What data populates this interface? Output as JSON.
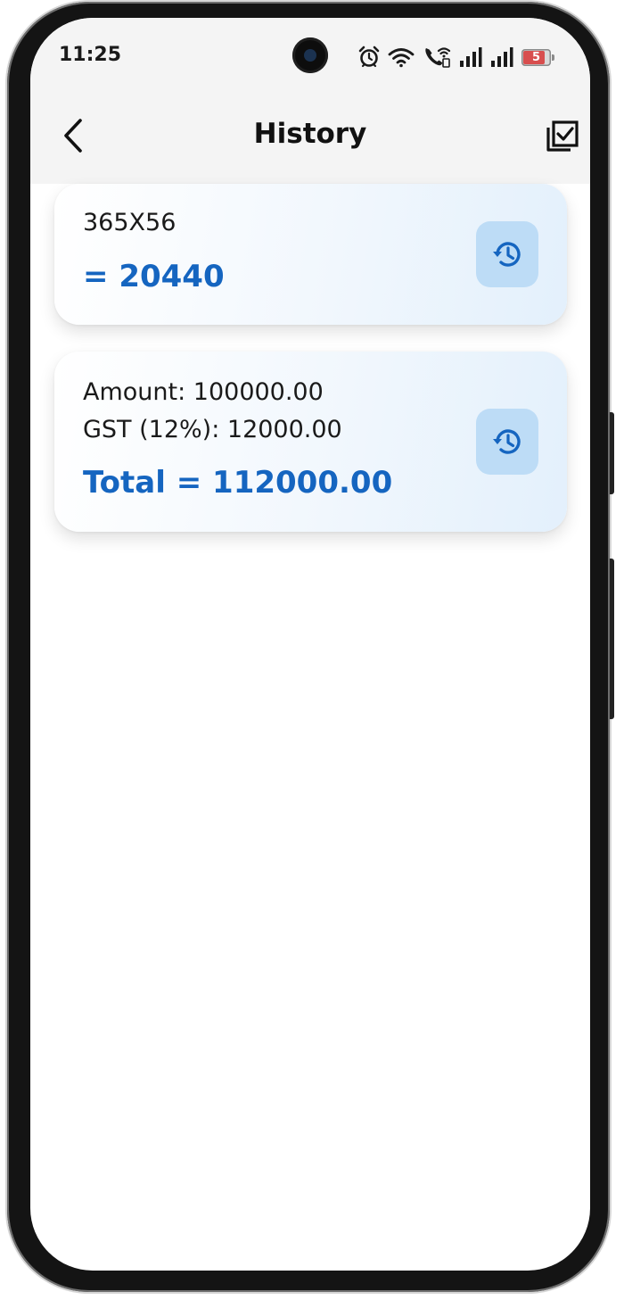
{
  "status_bar": {
    "time": "11:25",
    "battery_level": "5",
    "icons": [
      "alarm-icon",
      "wifi-icon",
      "wifi-calling-icon",
      "signal-icon",
      "signal-icon",
      "battery-icon"
    ]
  },
  "header": {
    "title": "History",
    "back_icon": "chevron-left-icon",
    "select_icon": "select-all-checkbox-icon"
  },
  "history": [
    {
      "lines": [
        "365X56"
      ],
      "result": "= 20440",
      "action_icon": "restore-history-icon"
    },
    {
      "lines": [
        "Amount: 100000.00",
        "GST (12%): 12000.00"
      ],
      "result": "Total = 112000.00",
      "action_icon": "restore-history-icon"
    }
  ],
  "colors": {
    "accent": "#1565c0",
    "restore_button_bg": "#bddcf6",
    "header_bg": "#f4f4f4",
    "battery_low": "#d84e4e"
  }
}
